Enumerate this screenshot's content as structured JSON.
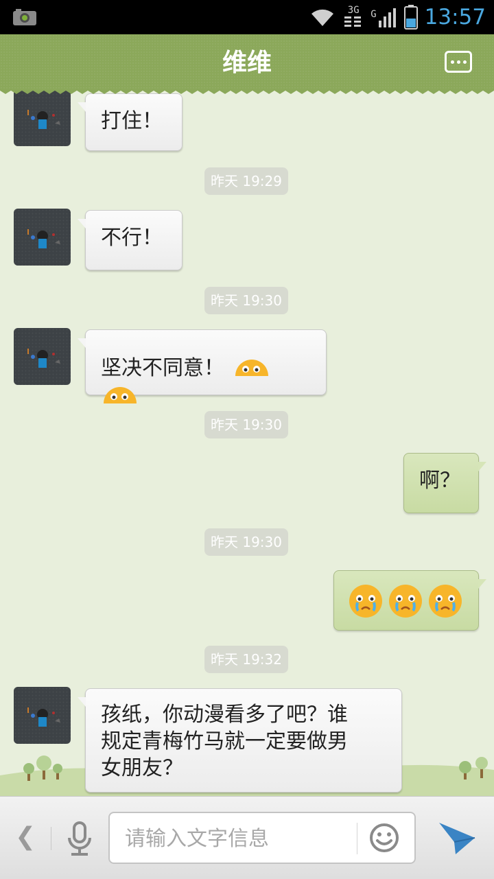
{
  "status_bar": {
    "time": "13:57",
    "network_3g": "3G",
    "network_g": "G",
    "icons": [
      "camera-notification-icon",
      "wifi-icon",
      "signal-icon",
      "battery-icon"
    ]
  },
  "header": {
    "title": "维维",
    "menu_icon": "more-icon"
  },
  "messages": [
    {
      "type": "text",
      "side": "left",
      "text": "打住！"
    },
    {
      "type": "timestamp",
      "text": "昨天 19:29"
    },
    {
      "type": "text",
      "side": "left",
      "text": "不行！"
    },
    {
      "type": "timestamp",
      "text": "昨天 19:30"
    },
    {
      "type": "text",
      "side": "left",
      "text": "坚决不同意！",
      "emojis": [
        "worried-face",
        "worried-face"
      ]
    },
    {
      "type": "timestamp",
      "text": "昨天 19:30"
    },
    {
      "type": "text",
      "side": "right",
      "text": "啊？"
    },
    {
      "type": "timestamp",
      "text": "昨天 19:30"
    },
    {
      "type": "emoji",
      "side": "right",
      "emojis": [
        "crying-face",
        "crying-face",
        "crying-face"
      ]
    },
    {
      "type": "timestamp",
      "text": "昨天 19:32"
    },
    {
      "type": "text",
      "side": "left",
      "text_lines": [
        "孩纸，你动漫看多了吧？谁",
        "规定青梅竹马就一定要做男",
        "女朋友？"
      ]
    }
  ],
  "input_bar": {
    "placeholder": "请输入文字信息",
    "value": "",
    "icons": [
      "back-icon",
      "microphone-icon",
      "emoji-icon",
      "send-icon"
    ]
  },
  "colors": {
    "header": "#8ba85a",
    "chat_bg": "#e8efdc",
    "time": "#4aa8e0",
    "sent_bubble": "#d1e2b1",
    "send_icon": "#3a84c4"
  }
}
